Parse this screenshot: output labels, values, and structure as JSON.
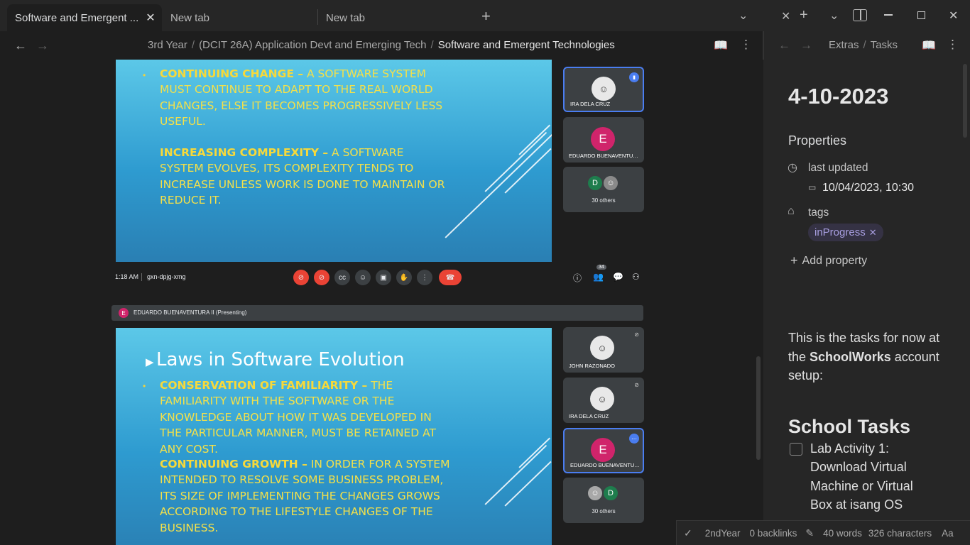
{
  "tabs": [
    {
      "label": "Software and Emergent ..."
    },
    {
      "label": "New tab"
    },
    {
      "label": "New tab"
    }
  ],
  "breadcrumb": {
    "items": [
      "3rd Year",
      "(DCIT 26A) Application Devt and Emerging Tech",
      "Software and Emergent Technologies"
    ],
    "separator": "/"
  },
  "right_breadcrumb": {
    "items": [
      "Extras",
      "Tasks"
    ],
    "separator": "/"
  },
  "meet_top": {
    "slide_text": {
      "item1_head": "CONTINUING CHANGE –",
      "item1_body": " A SOFTWARE SYSTEM MUST CONTINUE TO ADAPT TO THE REAL WORLD CHANGES, ELSE IT BECOMES PROGRESSIVELY LESS USEFUL.",
      "item2_head": "INCREASING COMPLEXITY –",
      "item2_body": " A SOFTWARE SYSTEM EVOLVES, ITS COMPLEXITY TENDS TO INCREASE UNLESS WORK IS DONE TO MAINTAIN OR REDUCE IT."
    },
    "participants": [
      {
        "name": "IRA DELA CRUZ"
      },
      {
        "name": "EDUARDO BUENAVENTURA",
        "initial": "E"
      },
      {
        "others": "30 others",
        "initial": "D"
      }
    ],
    "toolbar": {
      "time": "1:18 AM",
      "meeting_code": "gxn-dpjg-xmg",
      "people_count": "34"
    }
  },
  "meet_bottom": {
    "presenter": {
      "initial": "E",
      "label": "EDUARDO BUENAVENTURA II (Presenting)"
    },
    "slide_title": "Laws in Software Evolution",
    "slide_text": {
      "item1_head": "CONSERVATION OF FAMILIARITY –",
      "item1_body": " THE FAMILIARITY WITH THE SOFTWARE OR THE KNOWLEDGE ABOUT HOW IT WAS DEVELOPED IN THE PARTICULAR MANNER, MUST BE RETAINED AT ANY COST.",
      "item2_head": "CONTINUING GROWTH –",
      "item2_body": " IN ORDER FOR A SYSTEM INTENDED TO RESOLVE SOME BUSINESS PROBLEM, ITS SIZE OF IMPLEMENTING THE CHANGES GROWS ACCORDING TO THE LIFESTYLE CHANGES OF THE BUSINESS."
    },
    "participants": [
      {
        "name": "JOHN RAZONADO"
      },
      {
        "name": "IRA DELA CRUZ"
      },
      {
        "name": "EDUARDO BUENAVENTURA",
        "initial": "E"
      },
      {
        "others": "30 others",
        "initial": "D"
      }
    ]
  },
  "note": {
    "title": "4-10-2023",
    "properties_heading": "Properties",
    "last_updated_label": "last updated",
    "last_updated_value": "10/04/2023, 10:30",
    "tags_label": "tags",
    "tag": "inProgress",
    "add_property": "Add property",
    "intro_pre": "This is the tasks for now at the ",
    "intro_bold": "SchoolWorks",
    "intro_post": " account setup:",
    "tasks_heading": "School Tasks",
    "task1": "Lab Activity 1: Download Virtual Machine or Virtual Box at isang OS"
  },
  "status": {
    "tag": "2ndYear",
    "backlinks": "0 backlinks",
    "words": "40 words",
    "characters": "326 characters",
    "font_toggle": "Aa"
  },
  "colors": {
    "accent": "#4a7df0",
    "slide_text": "#f3e04a",
    "meet_red": "#ea4335",
    "avatar_pink": "#d0246b",
    "avatar_green": "#1e7d4d"
  }
}
